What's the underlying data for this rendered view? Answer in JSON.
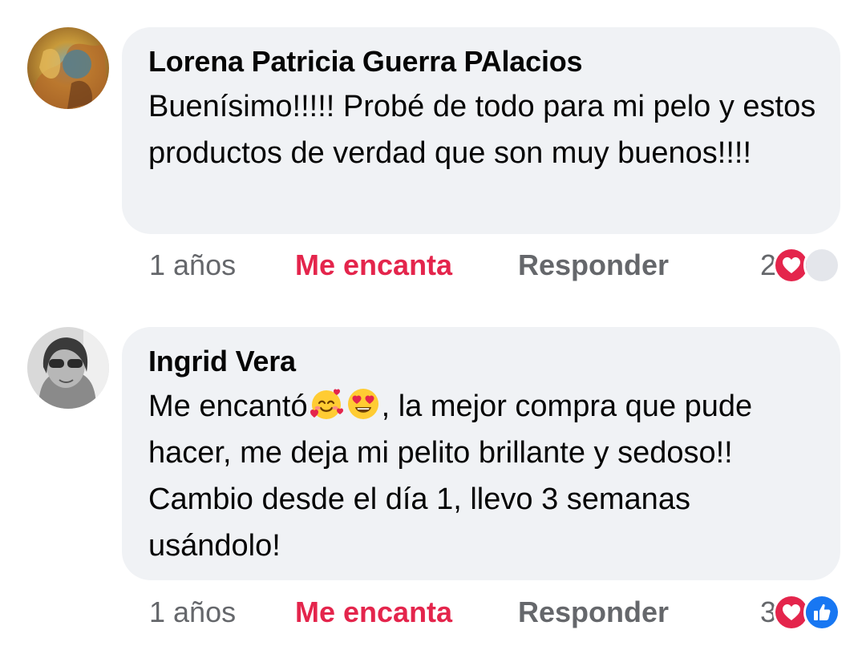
{
  "comments": [
    {
      "author": "Lorena Patricia Guerra PAlacios",
      "text": "Buenísimo!!!!! Probé de todo para mi pelo y estos productos de verdad que son muy buenos!!!!",
      "time": "1 años",
      "love_label": "Me encanta",
      "reply_label": "Responder",
      "reaction_count": "2",
      "reaction_icons": [
        "heart-icon",
        "gray-reaction-icon"
      ]
    },
    {
      "author": "Ingrid Vera",
      "text_before_emoji": "Me encantó",
      "emojis": [
        "smiling-face-with-hearts-icon",
        "heart-eyes-icon"
      ],
      "text_after_emoji": ",  la mejor compra que pude hacer, me deja mi pelito brillante y sedoso!! Cambio desde el día 1, llevo 3 semanas usándolo!",
      "time": "1 años",
      "love_label": "Me encanta",
      "reply_label": "Responder",
      "reaction_count": "3",
      "reaction_icons": [
        "heart-icon",
        "like-icon"
      ]
    }
  ],
  "colors": {
    "bubble_bg": "#f0f2f5",
    "love_red": "#e4254c",
    "meta_gray": "#65676b",
    "like_blue": "#1877f2"
  }
}
